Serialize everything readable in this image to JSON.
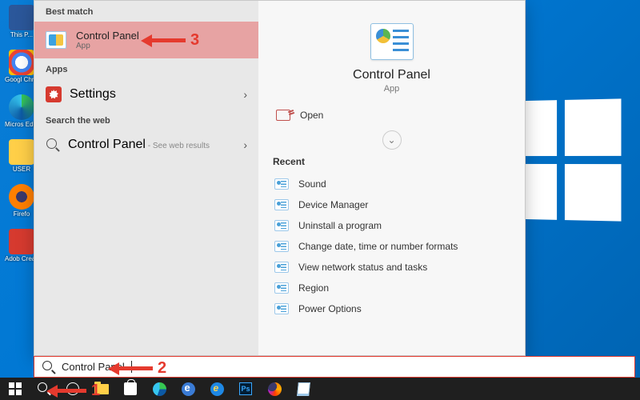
{
  "desktop": {
    "icons": [
      {
        "label": "This P...",
        "color": "#2b579a"
      },
      {
        "label": "Googl\nChrom",
        "color": "#ffffff"
      },
      {
        "label": "Micros\nEdge",
        "color": "#1e88e5"
      },
      {
        "label": "USER",
        "color": "#f2b705"
      },
      {
        "label": "Firefo",
        "color": "#ff7f00"
      },
      {
        "label": "Adob\nCreati",
        "color": "#d63a2f"
      }
    ]
  },
  "search": {
    "bestMatchHeader": "Best match",
    "bestMatch": {
      "title": "Control Panel",
      "subtitle": "App"
    },
    "appsHeader": "Apps",
    "settingsLabel": "Settings",
    "webHeader": "Search the web",
    "webResult": {
      "title": "Control Panel",
      "suffix": " - See web results"
    }
  },
  "preview": {
    "title": "Control Panel",
    "subtitle": "App",
    "openLabel": "Open",
    "recentHeader": "Recent",
    "recent": [
      "Sound",
      "Device Manager",
      "Uninstall a program",
      "Change date, time or number formats",
      "View network status and tasks",
      "Region",
      "Power Options"
    ]
  },
  "searchBox": {
    "value": "Control Panel"
  },
  "annotations": {
    "a1": "1",
    "a2": "2",
    "a3": "3"
  }
}
